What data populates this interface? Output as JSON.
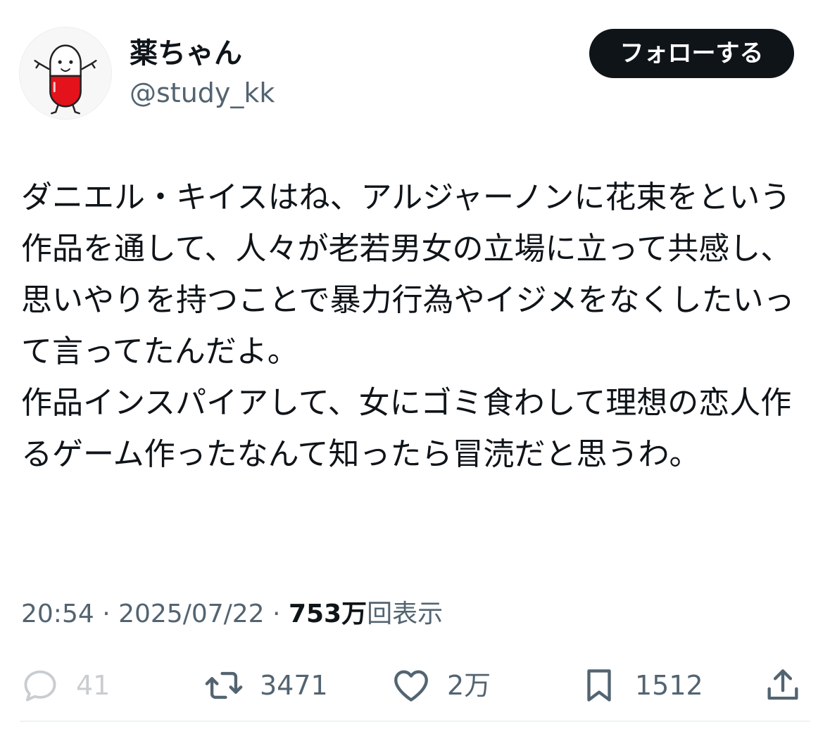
{
  "user": {
    "display_name": "薬ちゃん",
    "handle": "@study_kk",
    "avatar_icon": "pill-character-icon"
  },
  "follow_button": {
    "label": "フォローする"
  },
  "tweet": {
    "text": "ダニエル・キイスはね、アルジャーノンに花束をという作品を通して、人々が老若男女の立場に立って共感し、思いやりを持つことで暴力行為やイジメをなくしたいって言ってたんだよ。\n作品インスパイアして、女にゴミ食わして理想の恋人作るゲーム作ったなんて知ったら冒涜だと思うわ。"
  },
  "meta": {
    "time": "20:54",
    "separator": " · ",
    "date": "2025/07/22",
    "views_count": "753万",
    "views_label": "回表示"
  },
  "actions": {
    "reply": {
      "icon": "reply-icon",
      "count": "41"
    },
    "retweet": {
      "icon": "retweet-icon",
      "count": "3471"
    },
    "like": {
      "icon": "heart-icon",
      "count": "2万"
    },
    "bookmark": {
      "icon": "bookmark-icon",
      "count": "1512"
    },
    "share": {
      "icon": "share-icon"
    }
  },
  "colors": {
    "text_primary": "#0f1419",
    "text_secondary": "#536471",
    "button_bg": "#0f1419",
    "button_text": "#ffffff",
    "reply_dim": "#c9cdd1",
    "divider": "#eff3f4"
  }
}
